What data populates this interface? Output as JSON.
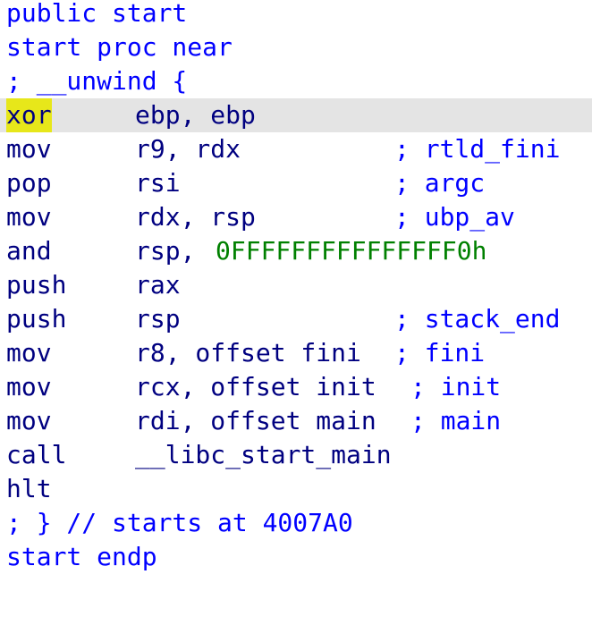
{
  "disassembly": {
    "header": {
      "public_line": "public start",
      "proc_line": "start proc near",
      "unwind_line": "; __unwind {"
    },
    "instructions": [
      {
        "mnemonic": "xor",
        "operands": "ebp, ebp",
        "comment": ""
      },
      {
        "mnemonic": "mov",
        "operands": "r9, rdx",
        "comment": "; rtld_fini"
      },
      {
        "mnemonic": "pop",
        "operands": "rsi",
        "comment": "; argc"
      },
      {
        "mnemonic": "mov",
        "operands": "rdx, rsp",
        "comment": "; ubp_av"
      },
      {
        "mnemonic": "and",
        "operands_prefix": "rsp, ",
        "operands_imm": "0FFFFFFFFFFFFFFF0h",
        "comment": ""
      },
      {
        "mnemonic": "push",
        "operands": "rax",
        "comment": ""
      },
      {
        "mnemonic": "push",
        "operands": "rsp",
        "comment": "; stack_end"
      },
      {
        "mnemonic": "mov",
        "operands": "r8, offset fini",
        "comment": "; fini"
      },
      {
        "mnemonic": "mov",
        "operands": "rcx, offset init",
        "comment": "; init"
      },
      {
        "mnemonic": "mov",
        "operands": "rdi, offset main",
        "comment": "; main"
      },
      {
        "mnemonic": "call",
        "operands": "__libc_start_main",
        "comment": ""
      },
      {
        "mnemonic": "hlt",
        "operands": "",
        "comment": ""
      }
    ],
    "footer": {
      "end_comment": "; } // starts at 4007A0",
      "endp_line": "start endp"
    },
    "highlighted_instruction_index": 0,
    "colors": {
      "keyword": "#0000ff",
      "instruction": "#000080",
      "immediate": "#008000",
      "comment": "#0000ff",
      "line_highlight": "#e4e4e4",
      "token_highlight": "#e7e71a"
    }
  }
}
